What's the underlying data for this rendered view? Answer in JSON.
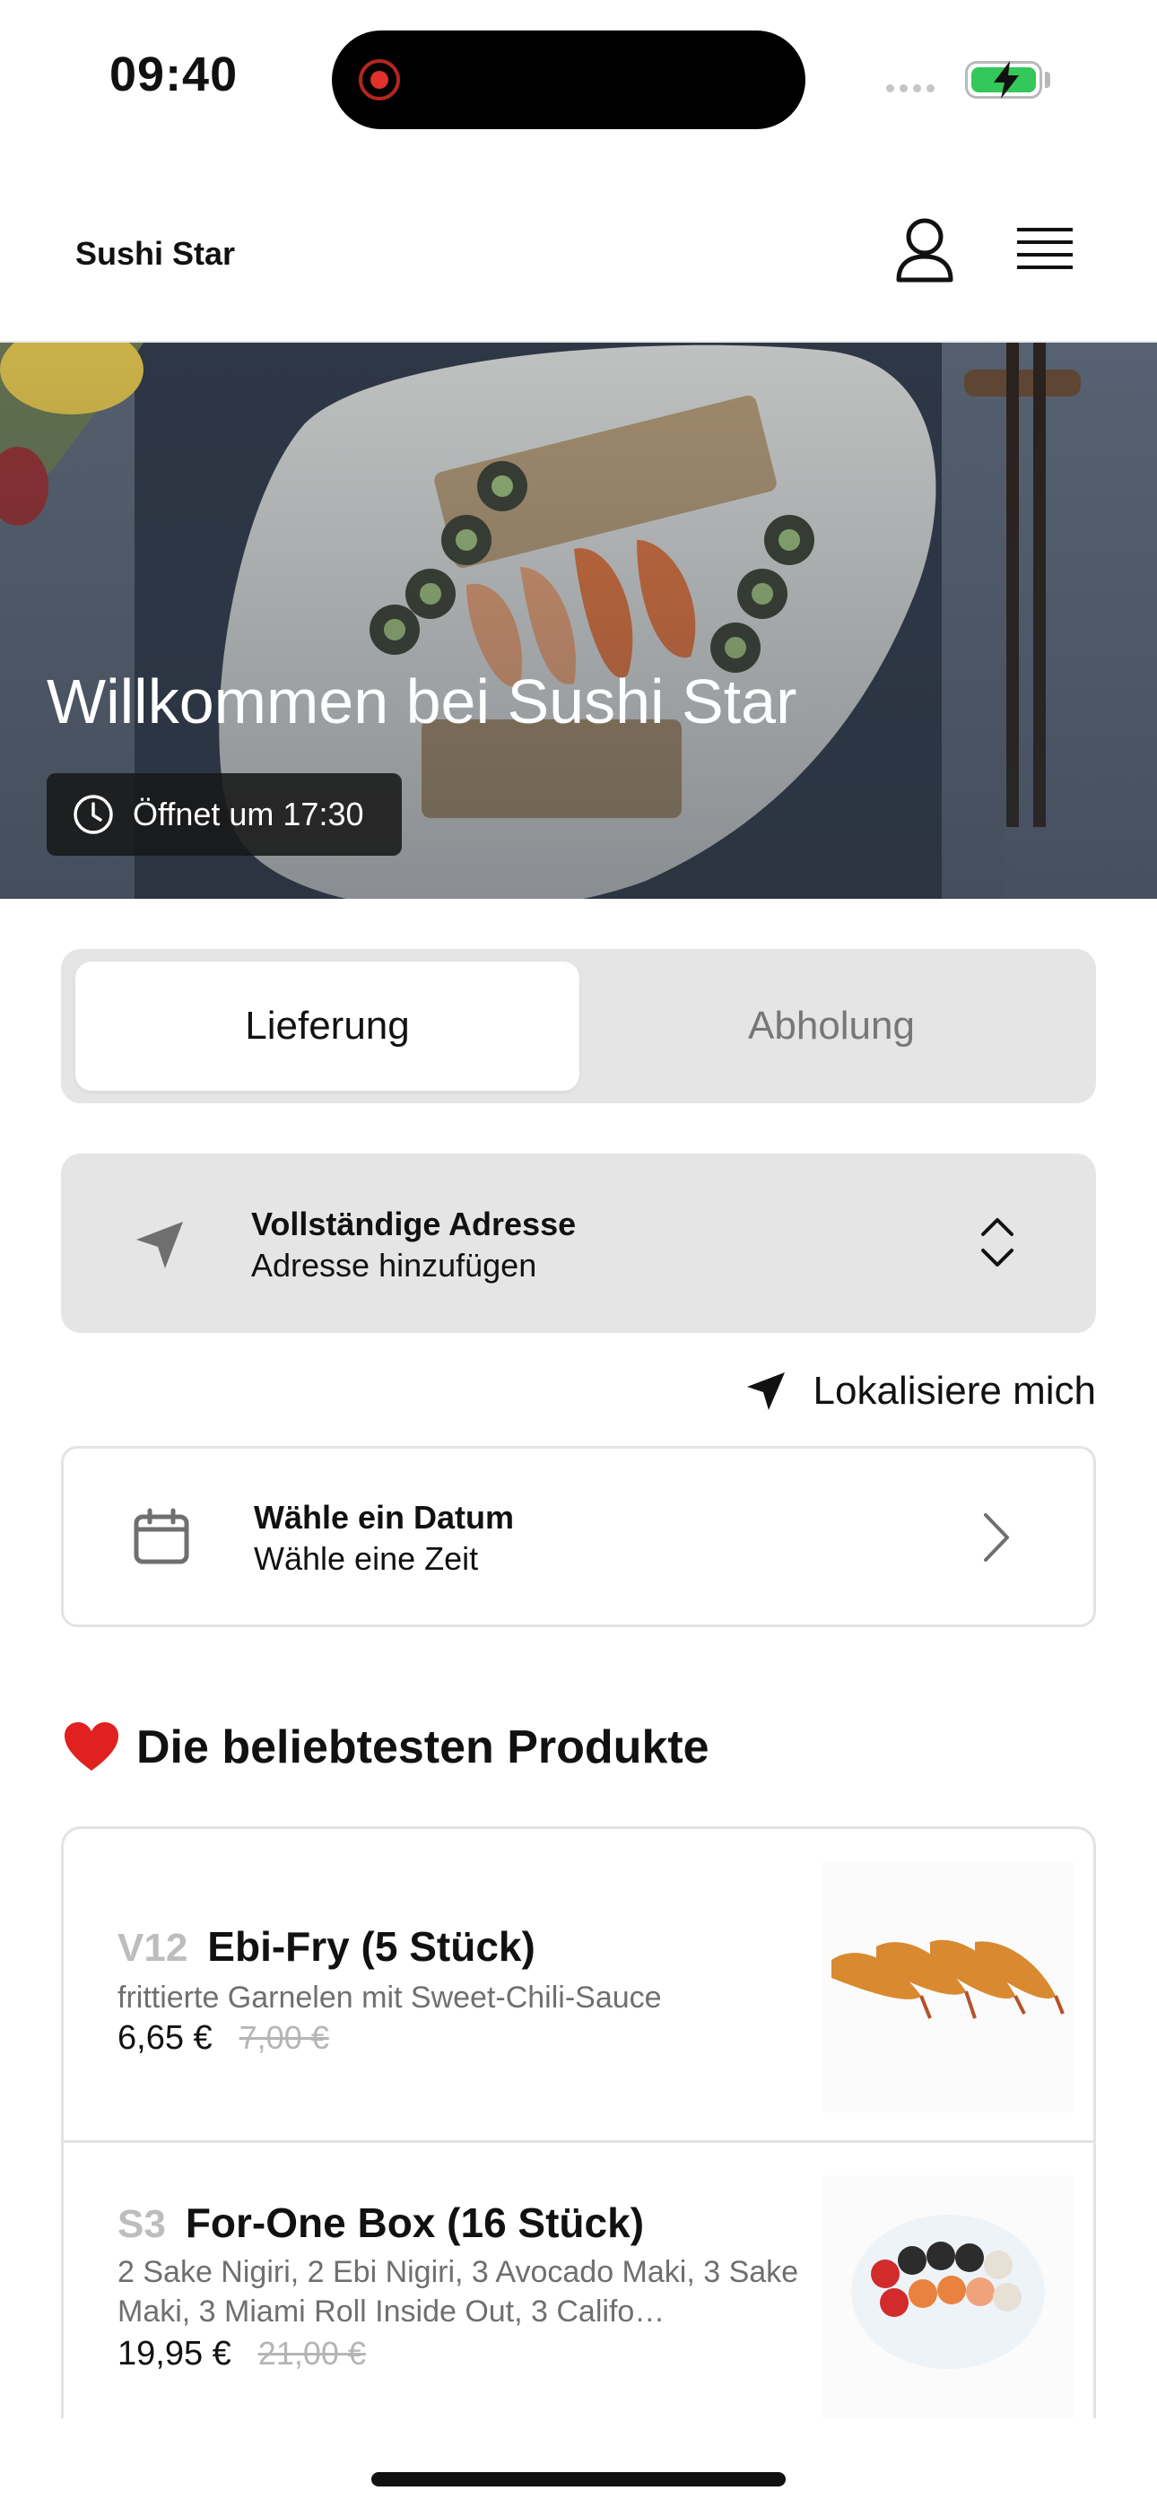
{
  "status_bar": {
    "time": "09:40"
  },
  "header": {
    "title": "Sushi Star"
  },
  "hero": {
    "title": "Willkommen bei Sushi Star",
    "opening": "Öffnet um 17:30"
  },
  "mode_tabs": [
    {
      "label": "Lieferung",
      "active": true
    },
    {
      "label": "Abholung",
      "active": false
    }
  ],
  "address": {
    "title": "Vollständige Adresse",
    "subtitle": "Adresse hinzufügen"
  },
  "locate": {
    "label": "Lokalisiere mich"
  },
  "datetime": {
    "title": "Wähle ein Datum",
    "subtitle": "Wähle eine Zeit"
  },
  "popular": {
    "heading": "Die beliebtesten Produkte",
    "products": [
      {
        "code": "V12",
        "name": "Ebi-Fry (5 Stück)",
        "description": "frittierte Garnelen mit Sweet-Chili-Sauce",
        "price": "6,65 €",
        "old_price": "7,00 €"
      },
      {
        "code": "S3",
        "name": "For-One Box (16 Stück)",
        "description": "2 Sake Nigiri, 2 Ebi Nigiri, 3 Avocado Maki, 3 Sake Maki, 3 Miami Roll Inside Out, 3 Califo…",
        "price": "19,95 €",
        "old_price": "21,00 €"
      }
    ]
  },
  "colors": {
    "accent_green": "#34c759",
    "record_red": "#e0312a",
    "panel_grey": "#e5e5e5"
  }
}
